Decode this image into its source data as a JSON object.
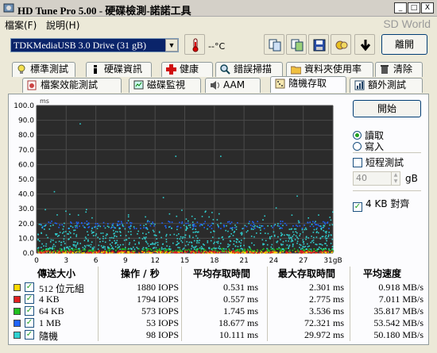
{
  "window": {
    "title": "HD Tune Pro  5.00 - 硬碟檢測-諾諾工具",
    "min_label": "_",
    "max_label": "□",
    "close_label": "X"
  },
  "menu": {
    "items": [
      "檔案(F)",
      "說明(H)"
    ],
    "brand": "SD World"
  },
  "toolbar": {
    "drive": "TDKMediaUSB 3.0 Drive     (31 gB)",
    "temperature": "--°C",
    "exit_label": "離開",
    "buttons": [
      "copy-text-icon",
      "copy-image-icon",
      "save-icon",
      "options-icon",
      "download-icon"
    ]
  },
  "tabs_row1": [
    "標準測試",
    "硬碟資訊",
    "健康",
    "錯誤掃描",
    "資料夾使用率",
    "清除"
  ],
  "tabs_row2": [
    "檔案效能測試",
    "磁碟監視",
    "AAM",
    "隨機存取",
    "額外測試"
  ],
  "active_tab": "隨機存取",
  "controls": {
    "start_label": "開始",
    "read_label": "讀取",
    "write_label": "寫入",
    "mode": "read",
    "short_test_label": "短程測試",
    "short_test_checked": false,
    "short_value": "40",
    "short_unit": "gB",
    "align_label": "4 KB 對齊",
    "align_checked": true
  },
  "chart_data": {
    "type": "scatter",
    "ylabel": "ms",
    "xlabel": "",
    "x_tick_labels": [
      "0",
      "3",
      "6",
      "9",
      "12",
      "15",
      "18",
      "21",
      "24",
      "27",
      "31gB"
    ],
    "y_tick_labels": [
      "100.0",
      "90.0",
      "80.0",
      "70.0",
      "60.0",
      "50.0",
      "40.0",
      "30.0",
      "20.0",
      "10.0",
      "0.0"
    ],
    "xlim": [
      0,
      31
    ],
    "ylim": [
      0,
      100
    ],
    "grid": true,
    "series": [
      {
        "name": "512 位元組",
        "color": "#ffd800",
        "y_range": [
          0.3,
          1.5
        ]
      },
      {
        "name": "4 KB",
        "color": "#e02020",
        "y_range": [
          0.4,
          2.0
        ]
      },
      {
        "name": "64 KB",
        "color": "#20c020",
        "y_range": [
          1.5,
          3.5
        ]
      },
      {
        "name": "1 MB",
        "color": "#1e64ff",
        "y_range": [
          17,
          22
        ]
      },
      {
        "name": "隨機",
        "color": "#30d0d0",
        "y_range": [
          3,
          30
        ]
      }
    ]
  },
  "results": {
    "headers": [
      "傳送大小",
      "操作 / 秒",
      "平均存取時間",
      "最大存取時間",
      "平均速度"
    ],
    "rows": [
      {
        "color": "#ffd800",
        "label": "512 位元組",
        "ops": "1880 IOPS",
        "avg": "0.531 ms",
        "max": "2.301 ms",
        "speed": "0.918 MB/s"
      },
      {
        "color": "#e02020",
        "label": "4 KB",
        "ops": "1794 IOPS",
        "avg": "0.557 ms",
        "max": "2.775 ms",
        "speed": "7.011 MB/s"
      },
      {
        "color": "#20c020",
        "label": "64 KB",
        "ops": "573 IOPS",
        "avg": "1.745 ms",
        "max": "3.536 ms",
        "speed": "35.817 MB/s"
      },
      {
        "color": "#1e64ff",
        "label": "1 MB",
        "ops": "53 IOPS",
        "avg": "18.677 ms",
        "max": "72.321 ms",
        "speed": "53.542 MB/s"
      },
      {
        "color": "#30d0d0",
        "label": "隨機",
        "ops": "98 IOPS",
        "avg": "10.111 ms",
        "max": "29.972 ms",
        "speed": "50.180 MB/s"
      }
    ]
  }
}
